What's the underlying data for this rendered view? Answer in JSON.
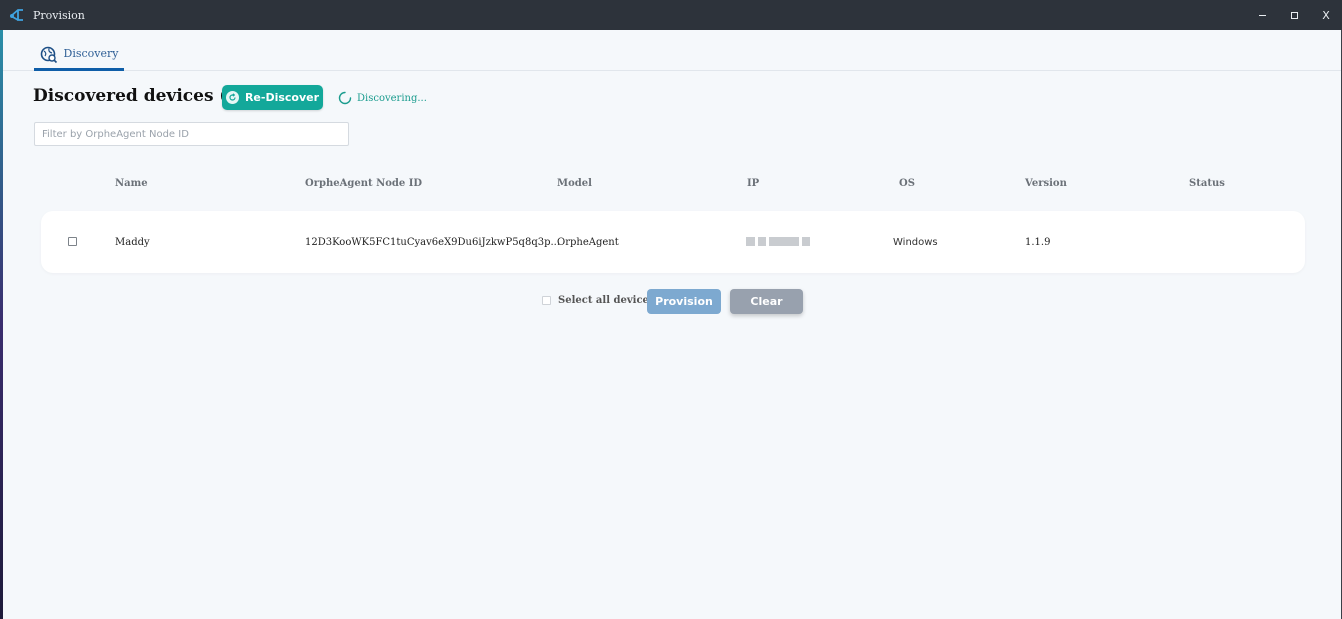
{
  "window": {
    "title": "Provision",
    "minimize_icon": "minimize-icon",
    "maximize_icon": "maximize-icon",
    "close_label": "X"
  },
  "tabs": [
    {
      "label": "Discovery",
      "icon": "discovery-globe-icon",
      "active": true
    }
  ],
  "main": {
    "heading": "Discovered devices (1 )",
    "rediscover_label": "Re-Discover",
    "status_text": "Discovering...",
    "filter_placeholder": "Filter by OrpheAgent Node ID"
  },
  "table": {
    "columns": [
      "Name",
      "OrpheAgent Node ID",
      "Model",
      "IP",
      "OS",
      "Version",
      "Status"
    ],
    "rows": [
      {
        "selected": false,
        "name": "Maddy",
        "node_id": "12D3KooWK5FC1tuCyav6eX9Du6iJzkwP5q8q3p...",
        "model": "OrpheAgent",
        "ip": "",
        "os": "Windows",
        "version": "1.1.9",
        "status": ""
      }
    ]
  },
  "footer": {
    "select_all_label": "Select all devices",
    "provision_label": "Provision",
    "clear_label": "Clear"
  },
  "colors": {
    "accent_teal": "#13a89a",
    "tab_active": "#0f5ea8",
    "provision_disabled": "#7da9d0",
    "clear": "#98a1ae"
  }
}
